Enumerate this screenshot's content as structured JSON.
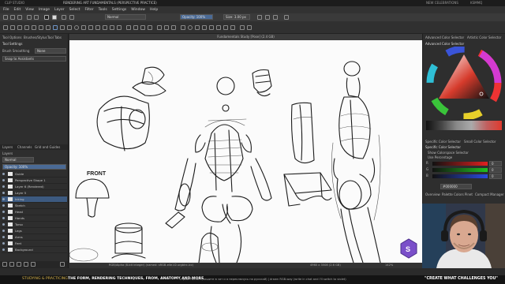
{
  "window": {
    "title_left": "CLIP STUDIO",
    "title_center": "RENDERING ART FUNDAMENTALS (PERSPECTIVE PRACTICE)",
    "title_right_a": "NEW CELEBRATIONS",
    "title_right_b": "KSMMQ"
  },
  "menu": [
    "File",
    "Edit",
    "View",
    "Image",
    "Layer",
    "Select",
    "Filter",
    "Tools",
    "Settings",
    "Window",
    "Help"
  ],
  "toolbar": {
    "blend_mode": "Normal",
    "opacity_label": "Opacity: 100%",
    "size_label": "Size: 3.00 px"
  },
  "left_panel": {
    "tabs": [
      "Tool Options",
      "Brushes/Stylus",
      "Tool Tabs"
    ],
    "tool_settings_label": "Tool Settings",
    "brush_smoothing_label": "Brush Smoothing",
    "brush_smoothing_value": "None",
    "snap_label": "Snap to Assistants",
    "layer_tabs": [
      "Layers",
      "Channels",
      "Grid and Guides"
    ],
    "layer_tabs_header": "Layers",
    "blend_value": "Normal",
    "opacity_value": "Opacity: 100%",
    "layers": [
      {
        "name": "Guide",
        "selected": false
      },
      {
        "name": "Perspective Shape 1",
        "selected": false
      },
      {
        "name": "Layer 6 (Rendered)",
        "selected": false
      },
      {
        "name": "Layer 5",
        "selected": false
      },
      {
        "name": "Inking",
        "selected": true
      },
      {
        "name": "Sketch",
        "selected": false
      },
      {
        "name": "Head",
        "selected": false
      },
      {
        "name": "Hands",
        "selected": false
      },
      {
        "name": "Torso",
        "selected": false
      },
      {
        "name": "Legs",
        "selected": false
      },
      {
        "name": "Arms",
        "selected": false
      },
      {
        "name": "Feet",
        "selected": false
      },
      {
        "name": "Background",
        "selected": false
      }
    ]
  },
  "canvas": {
    "title": "Fundamentals Study [Pose] (2.4 GB)",
    "sketch_label": "FRONT",
    "status_left": "RGB/Alpha (8-bit integer) (named: sRGB-elle-V2-srgbtrc.icc)",
    "status_right": "4960 x 3508 (2.6 GB)",
    "status_zoom": "142%"
  },
  "right_panel": {
    "tabs": [
      "Advanced Color Selector",
      "Artistic Color Selector"
    ],
    "section_title": "Advanced Color Selector",
    "sub_tabs": [
      "Specific Color Selector",
      "Small Color Selector"
    ],
    "specific_label": "Specific Color Selector",
    "color_space_label": "Show Colorspace Selector",
    "percentage_label": "Use Percentage",
    "channels": [
      {
        "name": "R",
        "value": "0"
      },
      {
        "name": "G",
        "value": "0"
      },
      {
        "name": "B",
        "value": "0"
      }
    ],
    "hex_value": "#000000",
    "bottom_tabs": [
      "Overview",
      "Palette Colors Pinet",
      "Compact Manager"
    ],
    "accent_color": "#e03a2e"
  },
  "bottom_bar": {
    "left": "STUDYING & PRACTICING",
    "middle": "THE FORM, RENDERING TECHNIQUES, FROM, ANATOMY AND MORE",
    "info": "стрим PNC-art (пишите в чат и я переключусь на русский) | drawn RGB-way (write in chat and I'll switch to violet)",
    "right": "\"CREATE WHAT CHALLENGES YOU\""
  }
}
